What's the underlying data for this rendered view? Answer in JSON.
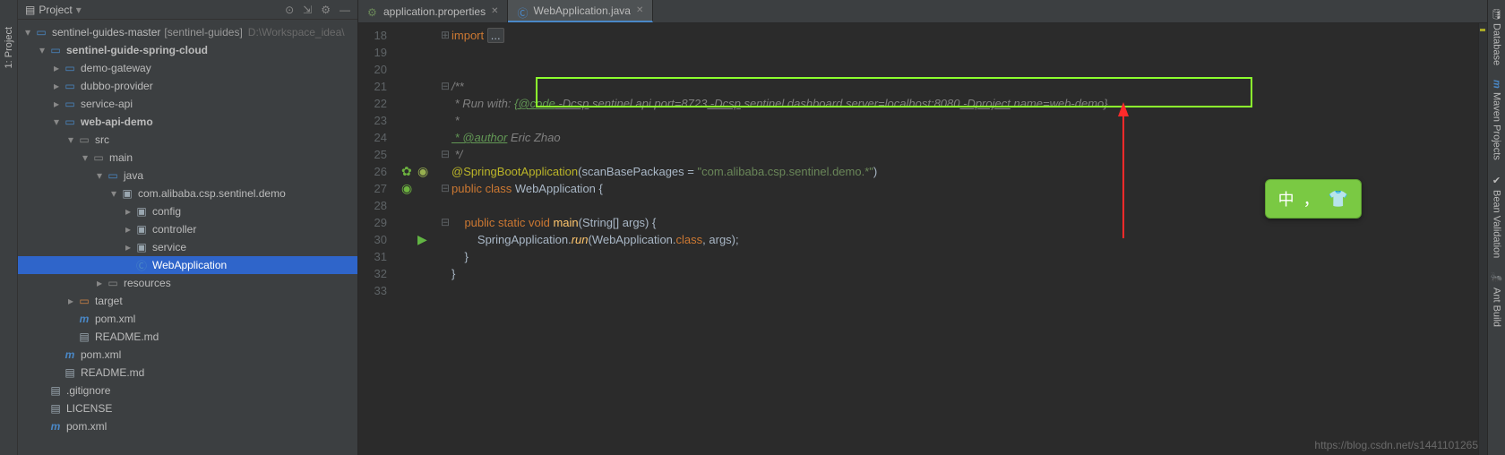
{
  "leftRail": {
    "project": "1: Project"
  },
  "projectPanel": {
    "title": "Project",
    "tree": {
      "root": {
        "name": "sentinel-guides-master",
        "bracket": "[sentinel-guides]",
        "hint": "D:\\Workspace_idea\\"
      },
      "module": "sentinel-guide-spring-cloud",
      "mods": [
        "demo-gateway",
        "dubbo-provider",
        "service-api",
        "web-api-demo"
      ],
      "src": "src",
      "main": "main",
      "java": "java",
      "pkg": "com.alibaba.csp.sentinel.demo",
      "subpkgs": [
        "config",
        "controller",
        "service"
      ],
      "cls": "WebApplication",
      "resources": "resources",
      "target": "target",
      "pom": "pom.xml",
      "readme": "README.md",
      "pom2": "pom.xml",
      "readme2": "README.md",
      "gitignore": ".gitignore",
      "license": "LICENSE",
      "pom3": "pom.xml"
    }
  },
  "tabs": [
    {
      "label": "application.properties",
      "active": false
    },
    {
      "label": "WebApplication.java",
      "active": true
    }
  ],
  "lines": [
    "18",
    "19",
    "20",
    "21",
    "22",
    "23",
    "24",
    "25",
    "26",
    "27",
    "28",
    "29",
    "30",
    "31",
    "32",
    "33"
  ],
  "code": {
    "import": "import ",
    "cmt_open": "/**",
    "run_prefix": " * Run with: ",
    "run_code": "{@code",
    "run_d1": " -Dcsp",
    "run_p1": ".sentinel.api.port=8723",
    "run_d2": " -Dcsp",
    "run_p2": ".sentinel.dashboard.server=localhost:8080",
    "run_d3": " -Dproject",
    "run_p3": ".name=web-demo}.",
    "star": " *",
    "author_tag": " * @author",
    "author_name": " Eric Zhao",
    "cmt_close": " */",
    "ann": "@SpringBootApplication",
    "ann_open": "(",
    "ann_key": "scanBasePackages",
    "ann_eq": " = ",
    "ann_str": "\"com.alibaba.csp.sentinel.demo.*\"",
    "ann_close": ")",
    "pub_cls": "public class ",
    "cls_name": "WebApplication",
    "brace_o": " {",
    "main_sig1": "    public static void ",
    "main_name": "main",
    "main_sig2": "(String[] args) {",
    "run_line1": "        SpringApplication.",
    "run_fn": "run",
    "run_line2": "(WebApplication.",
    "run_cls": "class",
    "run_line3": ", args);",
    "brace_c1": "    }",
    "brace_c2": "}"
  },
  "rightRail": [
    "Database",
    "Maven Projects",
    "Bean Validation",
    "Ant Build"
  ],
  "ime": {
    "char": "中",
    "comma": "，"
  },
  "watermark": "https://blog.csdn.net/s1441101265"
}
